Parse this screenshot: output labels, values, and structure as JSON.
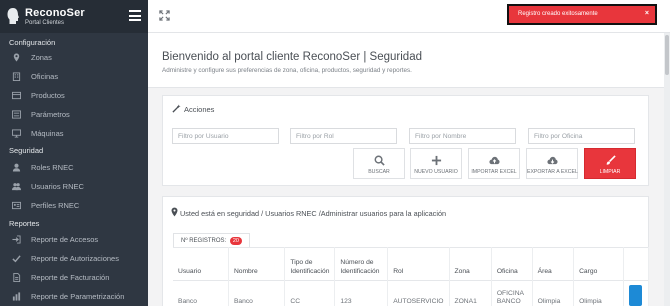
{
  "brand": {
    "name": "ReconoSer",
    "subtitle": "Portal Clientes"
  },
  "sidebar": {
    "sections": [
      {
        "title": "Configuración",
        "items": [
          {
            "label": "Zonas",
            "icon": "map-marker-icon"
          },
          {
            "label": "Oficinas",
            "icon": "building-icon"
          },
          {
            "label": "Productos",
            "icon": "box-icon"
          },
          {
            "label": "Parámetros",
            "icon": "sliders-icon"
          },
          {
            "label": "Máquinas",
            "icon": "monitor-icon"
          }
        ]
      },
      {
        "title": "Seguridad",
        "items": [
          {
            "label": "Roles RNEC",
            "icon": "user-icon"
          },
          {
            "label": "Usuarios RNEC",
            "icon": "users-icon"
          },
          {
            "label": "Perfiles RNEC",
            "icon": "id-card-icon"
          }
        ]
      },
      {
        "title": "Reportes",
        "items": [
          {
            "label": "Reporte de Accesos",
            "icon": "signin-icon"
          },
          {
            "label": "Reporte de Autorizaciones",
            "icon": "check-icon"
          },
          {
            "label": "Reporte de Facturación",
            "icon": "file-icon"
          },
          {
            "label": "Reporte de Parametrización",
            "icon": "chart-icon"
          }
        ]
      }
    ]
  },
  "toast": {
    "message": "Registro creado exitosamente",
    "close": "×",
    "color": "#e8363c"
  },
  "page": {
    "title": "Bienvenido al portal cliente ReconoSer | Seguridad",
    "subtitle": "Administre y configure sus preferencias de zona, oficina, productos, seguridad y reportes."
  },
  "actions": {
    "title": "Acciones",
    "filters": [
      {
        "placeholder": "Filtro por Usuario"
      },
      {
        "placeholder": "Filtro por Rol"
      },
      {
        "placeholder": "Filtro por Nombre"
      },
      {
        "placeholder": "Filtro por Oficina"
      }
    ],
    "buttons": [
      {
        "label": "BUSCAR",
        "icon": "search-icon"
      },
      {
        "label": "NUEVO USUARIO",
        "icon": "plus-icon"
      },
      {
        "label": "IMPORTAR EXCEL",
        "icon": "cloud-upload-icon"
      },
      {
        "label": "EXPORTAR A EXCEL",
        "icon": "cloud-download-icon"
      },
      {
        "label": "LIMPIAR",
        "icon": "brush-icon"
      }
    ]
  },
  "users": {
    "breadcrumb": "Usted está en seguridad / Usuarios RNEC /Administrar usuarios para la aplicación",
    "records_label": "Nº REGISTROS:",
    "records_count": "20",
    "columns": [
      "Usuario",
      "Nombre",
      "Tipo de Identificación",
      "Número de Identificación",
      "Rol",
      "Zona",
      "Oficina",
      "Área",
      "Cargo"
    ],
    "rows": [
      [
        "Banco",
        "Banco",
        "CC",
        "123",
        "AUTOSERVICIO",
        "ZONA1",
        "OFICINA BANCO",
        "Olimpia",
        "Olimpia"
      ]
    ]
  },
  "colors": {
    "sidebar": "#2f3742",
    "accent_red": "#e8363c",
    "accent_blue": "#1d8ad6"
  }
}
